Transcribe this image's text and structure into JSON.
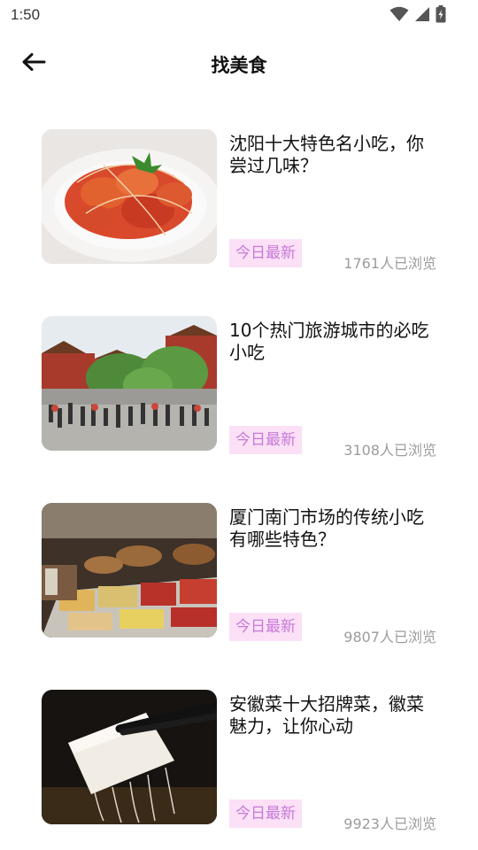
{
  "status_bar": {
    "time": "1:50",
    "icons": [
      "wifi-icon",
      "signal-icon",
      "battery-icon"
    ]
  },
  "header": {
    "back_icon": "arrow-left-icon",
    "title": "找美食"
  },
  "colors": {
    "tag_background": "#fbe0f6",
    "tag_text": "#c67ad9",
    "views_text": "#9c9c9c"
  },
  "articles": [
    {
      "title": "沈阳十大特色名小吃，你尝过几味？",
      "tag": "今日最新",
      "views": "1761人已浏览",
      "image": "fried-shrimp-dish-photo"
    },
    {
      "title": "10个热门旅游城市的必吃小吃",
      "tag": "今日最新",
      "views": "3108人已浏览",
      "image": "palace-crowd-photo"
    },
    {
      "title": "厦门南门市场的传统小吃有哪些特色？",
      "tag": "今日最新",
      "views": "9807人已浏览",
      "image": "market-stall-photo"
    },
    {
      "title": "安徽菜十大招牌菜，徽菜魅力，让你心动",
      "tag": "今日最新",
      "views": "9923人已浏览",
      "image": "chopsticks-tofu-photo"
    }
  ]
}
